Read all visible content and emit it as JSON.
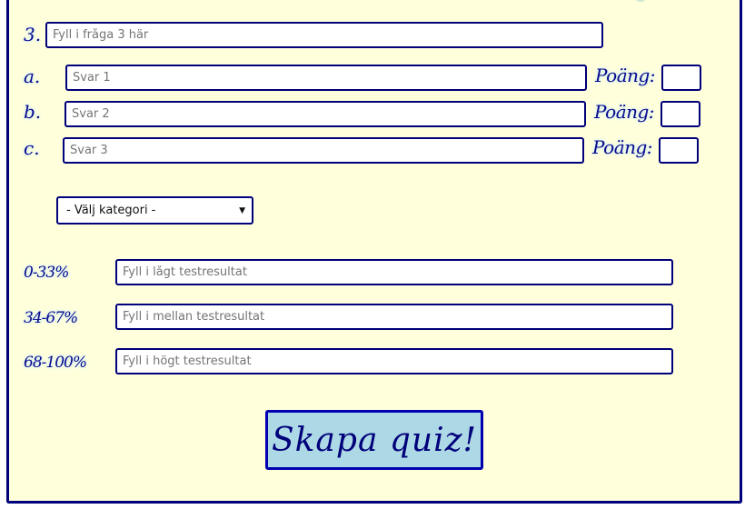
{
  "question": {
    "number": "3.",
    "placeholder": "Fyll i fråga 3 här"
  },
  "answers": [
    {
      "letter": "a.",
      "placeholder": "Svar 1",
      "points_label": "Poäng:"
    },
    {
      "letter": "b.",
      "placeholder": "Svar 2",
      "points_label": "Poäng:"
    },
    {
      "letter": "c.",
      "placeholder": "Svar 3",
      "points_label": "Poäng:"
    }
  ],
  "category": {
    "selected": "- Välj kategori -"
  },
  "results": [
    {
      "range": "0-33%",
      "placeholder": "Fyll i lågt testresultat"
    },
    {
      "range": "34-67%",
      "placeholder": "Fyll i mellan testresultat"
    },
    {
      "range": "68-100%",
      "placeholder": "Fyll i högt testresultat"
    }
  ],
  "submit_label": "Skapa  quiz!",
  "colors": {
    "background": "#ffffdc",
    "border": "#00007a",
    "label_text": "#0a0a8c",
    "label_glow": "#bfe6f5",
    "button_bg": "#add8e6"
  }
}
